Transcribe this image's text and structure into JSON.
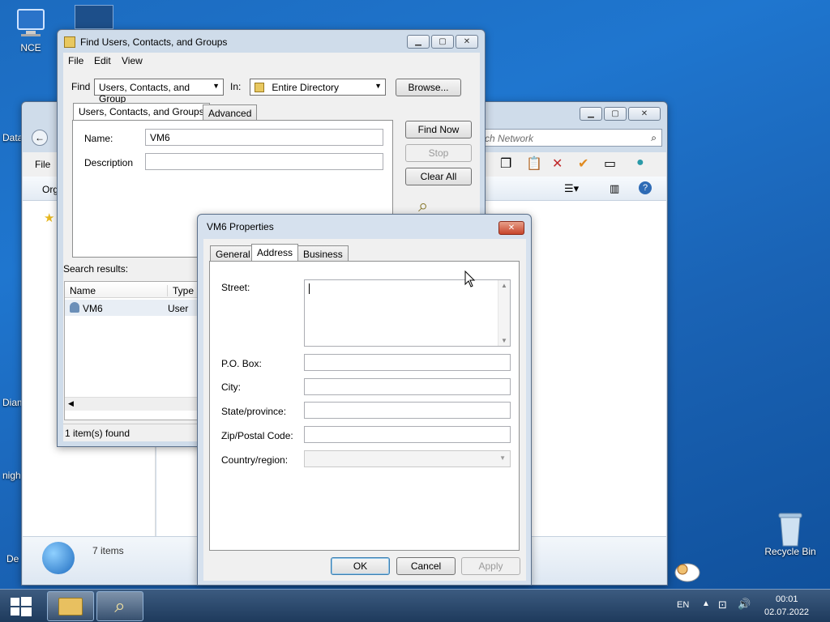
{
  "desktop": {
    "icons": [
      {
        "label": "NCE"
      },
      {
        "label": "Recycle Bin"
      }
    ],
    "partial_labels": [
      "Data",
      "Diam",
      "nigh",
      "De"
    ]
  },
  "explorer": {
    "search_placeholder": "rch Network",
    "menu_file": "File",
    "org_partial": "Org",
    "status": "7 items"
  },
  "find": {
    "title": "Find Users, Contacts, and Groups",
    "menu": [
      "File",
      "Edit",
      "View"
    ],
    "find_label": "Find",
    "find_value": "Users, Contacts, and Group",
    "in_label": "In:",
    "in_value": "Entire Directory",
    "browse": "Browse...",
    "tabs": [
      "Users, Contacts, and Groups",
      "Advanced"
    ],
    "name_label": "Name:",
    "name_value": "VM6",
    "desc_label": "Description",
    "find_now": "Find Now",
    "stop": "Stop",
    "clear_all": "Clear All",
    "results_label": "Search results:",
    "col_name": "Name",
    "col_type": "Type",
    "row": {
      "name": "VM6",
      "type": "User"
    },
    "status": "1 item(s) found"
  },
  "props": {
    "title": "VM6 Properties",
    "tabs": [
      "General",
      "Address",
      "Business"
    ],
    "street": "Street:",
    "pobox": "P.O. Box:",
    "city": "City:",
    "state": "State/province:",
    "zip": "Zip/Postal Code:",
    "country": "Country/region:",
    "ok": "OK",
    "cancel": "Cancel",
    "apply": "Apply"
  },
  "taskbar": {
    "lang": "EN",
    "time": "00:01",
    "date": "02.07.2022"
  }
}
